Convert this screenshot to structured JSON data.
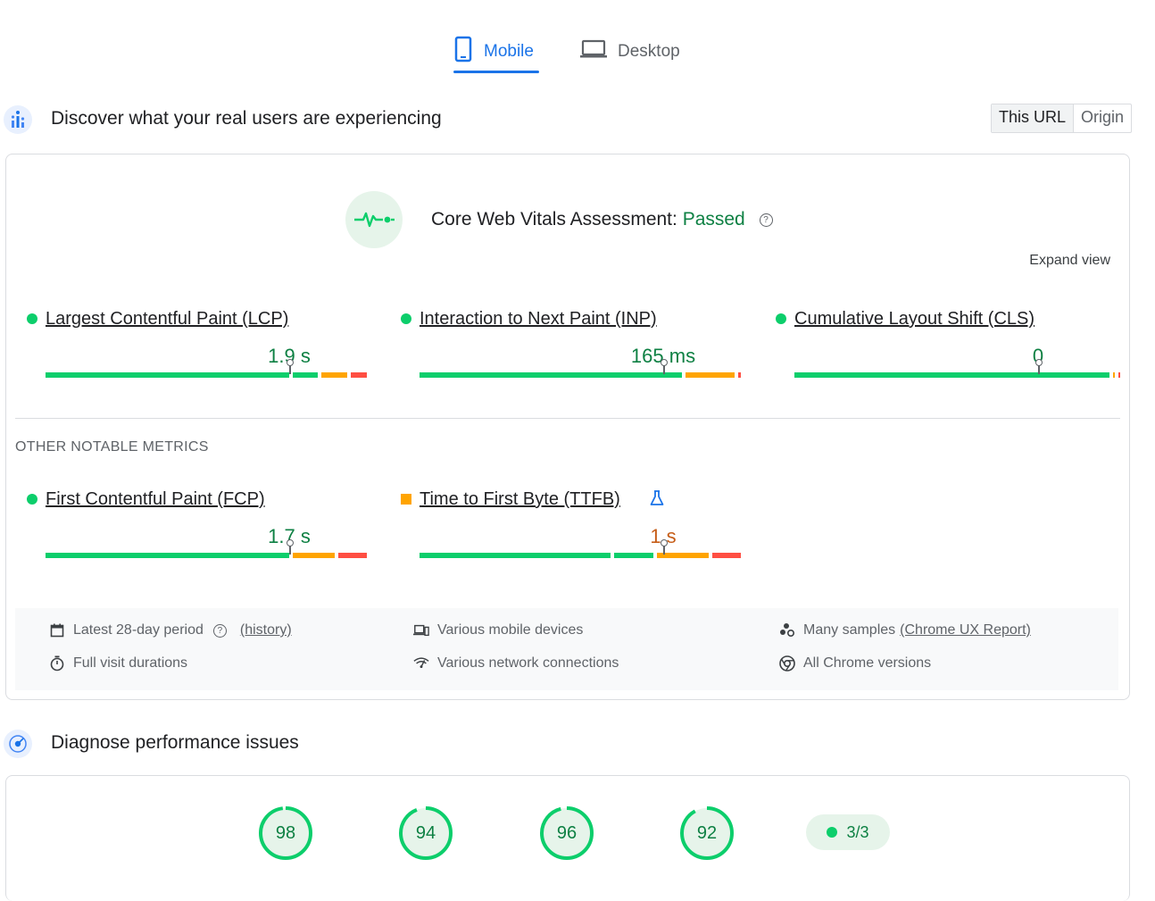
{
  "tabs": [
    {
      "label": "Mobile",
      "active": true
    },
    {
      "label": "Desktop",
      "active": false
    }
  ],
  "field_section": {
    "title": "Discover what your real users are experiencing",
    "toggle": {
      "this_url": "This URL",
      "origin": "Origin"
    }
  },
  "cwv": {
    "label": "Core Web Vitals Assessment:",
    "status": "Passed",
    "expand": "Expand view"
  },
  "metrics": [
    {
      "name": "Largest Contentful Paint (LCP)",
      "value": "1.9 s",
      "rating": "good",
      "marker": 0.75,
      "dist": [
        0.76,
        0.09,
        0.09,
        0.06
      ]
    },
    {
      "name": "Interaction to Next Paint (INP)",
      "value": "165 ms",
      "rating": "good",
      "marker": 0.75,
      "dist": [
        0.82,
        0.0,
        0.16,
        0.02
      ]
    },
    {
      "name": "Cumulative Layout Shift (CLS)",
      "value": "0",
      "rating": "good",
      "marker": 0.75,
      "dist": [
        0.98,
        0.0,
        0.01,
        0.01
      ]
    }
  ],
  "other_label": "OTHER NOTABLE METRICS",
  "other_metrics": [
    {
      "name": "First Contentful Paint (FCP)",
      "value": "1.7 s",
      "rating": "good",
      "marker": 0.75,
      "dist": [
        0.76,
        0.0,
        0.14,
        0.1
      ]
    },
    {
      "name": "Time to First Byte (TTFB)",
      "value": "1 s",
      "rating": "average",
      "marker": 0.75,
      "dist": [
        0.6,
        0.13,
        0.17,
        0.1
      ]
    }
  ],
  "info": {
    "period": "Latest 28-day period",
    "history": "(history)",
    "durations": "Full visit durations",
    "devices": "Various mobile devices",
    "network": "Various network connections",
    "samples_prefix": "Many samples",
    "samples_link": "(Chrome UX Report)",
    "chrome": "All Chrome versions"
  },
  "diag_section": {
    "title": "Diagnose performance issues"
  },
  "scores": [
    98,
    94,
    96,
    92
  ],
  "pwa": "3/3",
  "colors": {
    "good": "#0cce6b",
    "average": "#ffa400",
    "poor": "#ff4e42",
    "accent": "#1a73e8"
  }
}
